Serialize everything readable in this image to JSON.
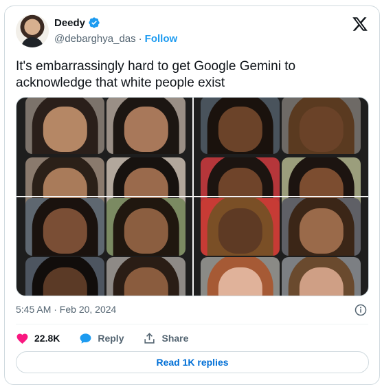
{
  "author": {
    "name": "Deedy",
    "handle": "@debarghya_das",
    "follow_label": "Follow",
    "verified": true
  },
  "platform_icon": "x-logo-icon",
  "tweet": {
    "text": "It's embarrassingly hard to get Google Gemini to acknowledge that white people exist",
    "timestamp": "5:45 AM · Feb 20, 2024"
  },
  "media": {
    "description_icon": "image-grid",
    "left_panel_tiles": 8,
    "right_panel_tiles": 8
  },
  "actions": {
    "like_icon": "heart-icon",
    "like_count": "22.8K",
    "reply_icon": "speech-bubble-icon",
    "reply_label": "Reply",
    "share_icon": "share-upload-icon",
    "share_label": "Share"
  },
  "replies_button": {
    "label": "Read 1K replies"
  },
  "colors": {
    "accent": "#1d9bf0",
    "like": "#f91880",
    "text_primary": "#0f1419",
    "text_secondary": "#536471",
    "border": "#cfd9de",
    "link_button": "#006fd6"
  }
}
